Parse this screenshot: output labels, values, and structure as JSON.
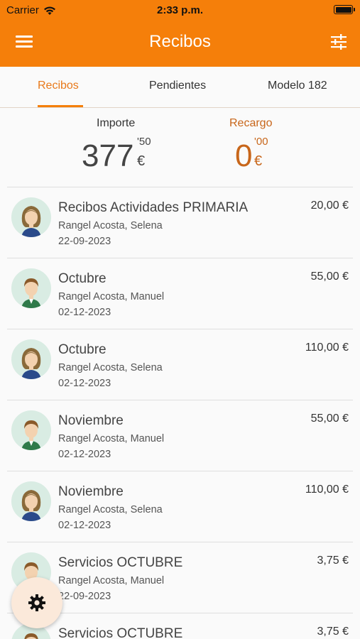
{
  "status_bar": {
    "carrier": "Carrier",
    "time": "2:33 p.m."
  },
  "header": {
    "title": "Recibos",
    "menu_icon": "hamburger-menu-icon",
    "filter_icon": "filter-sliders-icon"
  },
  "tabs": [
    {
      "label": "Recibos",
      "active": true
    },
    {
      "label": "Pendientes",
      "active": false
    },
    {
      "label": "Modelo 182",
      "active": false
    }
  ],
  "summary": {
    "importe": {
      "label": "Importe",
      "integer": "377",
      "decimals": "'50",
      "currency": "€"
    },
    "recargo": {
      "label": "Recargo",
      "integer": "0",
      "decimals": "'00",
      "currency": "€"
    }
  },
  "receipts": [
    {
      "title": "Recibos Actividades PRIMARIA",
      "person": "Rangel Acosta, Selena",
      "date": "22-09-2023",
      "amount": "20,00 €",
      "avatar": "girl"
    },
    {
      "title": "Octubre",
      "person": "Rangel Acosta, Manuel",
      "date": "02-12-2023",
      "amount": "55,00 €",
      "avatar": "boy"
    },
    {
      "title": "Octubre",
      "person": "Rangel Acosta, Selena",
      "date": "02-12-2023",
      "amount": "110,00 €",
      "avatar": "girl"
    },
    {
      "title": "Noviembre",
      "person": "Rangel Acosta, Manuel",
      "date": "02-12-2023",
      "amount": "55,00 €",
      "avatar": "boy"
    },
    {
      "title": "Noviembre",
      "person": "Rangel Acosta, Selena",
      "date": "02-12-2023",
      "amount": "110,00 €",
      "avatar": "girl"
    },
    {
      "title": "Servicios OCTUBRE",
      "person": "Rangel Acosta, Manuel",
      "date": "22-09-2023",
      "amount": "3,75 €",
      "avatar": "boy"
    },
    {
      "title": "Servicios OCTUBRE",
      "person": "",
      "date": "",
      "amount": "3,75 €",
      "avatar": "boy"
    }
  ],
  "fab": {
    "icon": "gear-icon"
  },
  "colors": {
    "brand": "#f57f0a",
    "accent_text": "#c8661a",
    "avatar_bg": "#d9ece3"
  }
}
